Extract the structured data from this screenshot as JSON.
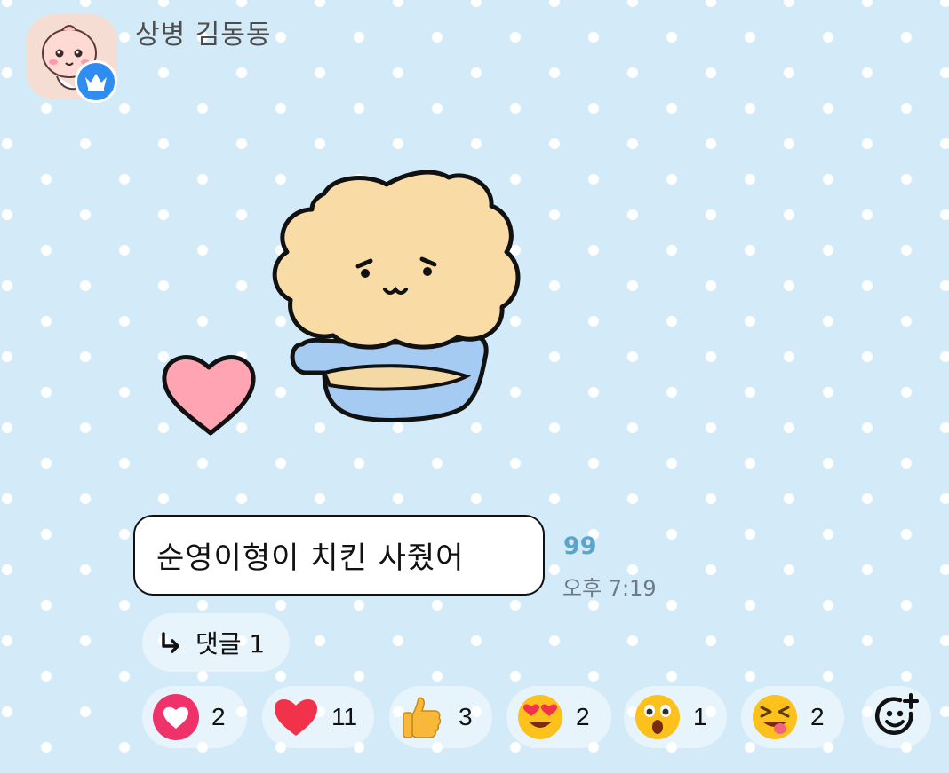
{
  "message": {
    "sender_name": "상병 김동동",
    "avatar_icon": "peach-character-avatar",
    "badge_icon": "crown-icon",
    "sticker_icon": "bear-sticker-with-heart",
    "text": "순영이형이 치킨 사줬어",
    "unread_count": "99",
    "time": "오후 7:19"
  },
  "reply": {
    "icon": "reply-arrow-icon",
    "label": "댓글 1"
  },
  "reactions": [
    {
      "icon": "heart-circle-icon",
      "count": "2"
    },
    {
      "icon": "red-heart-icon",
      "count": "11"
    },
    {
      "icon": "thumbs-up-icon",
      "count": "3"
    },
    {
      "icon": "heart-eyes-icon",
      "count": "2"
    },
    {
      "icon": "surprised-face-icon",
      "count": "1"
    },
    {
      "icon": "squinting-tongue-face-icon",
      "count": "2"
    }
  ],
  "add_reaction_icon": "add-reaction-icon",
  "colors": {
    "background": "#d3ebf8",
    "badge": "#2f8cf0",
    "unread": "#5aa6c9",
    "heart_circle": "#f0326b",
    "heart": "#f0334a"
  }
}
